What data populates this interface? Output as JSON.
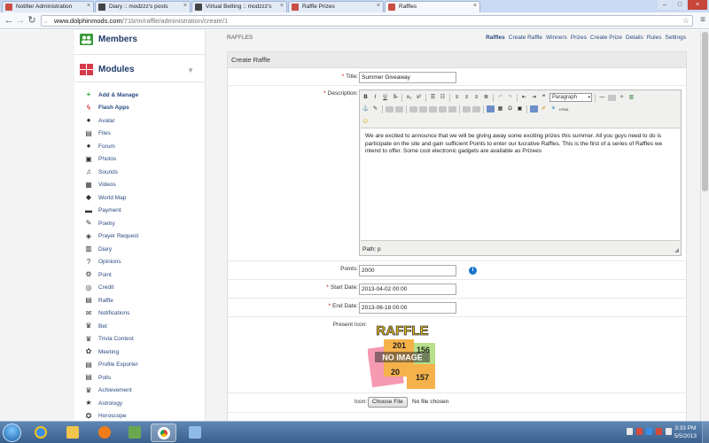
{
  "browser": {
    "tabs": [
      {
        "label": "Notifier Administration",
        "favicon_color": "#c94e44",
        "active": false
      },
      {
        "label": "Diary :: modzzz's posts",
        "favicon_color": "#444444",
        "active": false
      },
      {
        "label": "Virtual Betting :: modzzz's",
        "favicon_color": "#444444",
        "active": false
      },
      {
        "label": "Raffle Prizes",
        "favicon_color": "#c94e44",
        "active": false
      },
      {
        "label": "Raffles",
        "favicon_color": "#c94e44",
        "active": true
      }
    ],
    "url_host": "www.dolphinmods.com",
    "url_path": "/71b/m/raffle/administration/create/1"
  },
  "sidebar": {
    "members_label": "Members",
    "modules_label": "Modules",
    "items": [
      {
        "label": "Add & Manage",
        "icon": "plus-icon",
        "glyph": "+",
        "color": "#2e9e2e",
        "bold": true
      },
      {
        "label": "Flash Apps",
        "icon": "flash-icon",
        "glyph": "ϟ",
        "color": "#d42e2e",
        "bold": true
      },
      {
        "label": "Avatar",
        "icon": "avatar-icon",
        "glyph": "●",
        "color": "#333",
        "bold": false
      },
      {
        "label": "Files",
        "icon": "files-icon",
        "glyph": "▤",
        "color": "#333",
        "bold": false
      },
      {
        "label": "Forum",
        "icon": "forum-icon",
        "glyph": "●",
        "color": "#333",
        "bold": false
      },
      {
        "label": "Photos",
        "icon": "photos-icon",
        "glyph": "▣",
        "color": "#333",
        "bold": false
      },
      {
        "label": "Sounds",
        "icon": "sounds-icon",
        "glyph": "♫",
        "color": "#333",
        "bold": false
      },
      {
        "label": "Videos",
        "icon": "videos-icon",
        "glyph": "▦",
        "color": "#333",
        "bold": false
      },
      {
        "label": "World Map",
        "icon": "map-pin-icon",
        "glyph": "◆",
        "color": "#333",
        "bold": false
      },
      {
        "label": "Payment",
        "icon": "payment-icon",
        "glyph": "▬",
        "color": "#333",
        "bold": false
      },
      {
        "label": "Poetry",
        "icon": "pencil-icon",
        "glyph": "✎",
        "color": "#333",
        "bold": false
      },
      {
        "label": "Prayer Request",
        "icon": "tag-icon",
        "glyph": "◈",
        "color": "#333",
        "bold": false
      },
      {
        "label": "Diary",
        "icon": "diary-icon",
        "glyph": "▥",
        "color": "#333",
        "bold": false
      },
      {
        "label": "Opinions",
        "icon": "question-icon",
        "glyph": "?",
        "color": "#333",
        "bold": false
      },
      {
        "label": "Point",
        "icon": "point-icon",
        "glyph": "⚙",
        "color": "#333",
        "bold": false
      },
      {
        "label": "Credit",
        "icon": "credit-icon",
        "glyph": "◎",
        "color": "#333",
        "bold": false
      },
      {
        "label": "Raffle",
        "icon": "raffle-icon",
        "glyph": "▤",
        "color": "#333",
        "bold": false
      },
      {
        "label": "Notifications",
        "icon": "mail-icon",
        "glyph": "✉",
        "color": "#333",
        "bold": false
      },
      {
        "label": "Bet",
        "icon": "trophy-icon",
        "glyph": "♛",
        "color": "#333",
        "bold": false
      },
      {
        "label": "Trivia Contest",
        "icon": "trophy-icon",
        "glyph": "♛",
        "color": "#333",
        "bold": false
      },
      {
        "label": "Meeting",
        "icon": "meeting-icon",
        "glyph": "✿",
        "color": "#333",
        "bold": false
      },
      {
        "label": "Profile Exporter",
        "icon": "exporter-icon",
        "glyph": "▤",
        "color": "#333",
        "bold": false
      },
      {
        "label": "Polls",
        "icon": "polls-icon",
        "glyph": "▤",
        "color": "#333",
        "bold": false
      },
      {
        "label": "Achievement",
        "icon": "trophy-icon",
        "glyph": "♛",
        "color": "#333",
        "bold": false
      },
      {
        "label": "Astrology",
        "icon": "star-icon",
        "glyph": "★",
        "color": "#333",
        "bold": false
      },
      {
        "label": "Horoscope",
        "icon": "horoscope-icon",
        "glyph": "✪",
        "color": "#333",
        "bold": false
      }
    ]
  },
  "main": {
    "breadcrumb": "RAFFLES",
    "topnav": [
      "Raffles",
      "Create Raffle",
      "Winners",
      "Prizes",
      "Create Prize",
      "Details",
      "Rules",
      "Settings"
    ],
    "box_title": "Create Raffle",
    "form": {
      "title_label": "Title:",
      "title_value": "Summer Giveaway",
      "description_label": "Description:",
      "description_text": "We are excited to announce that we will be giving away some exciting prizes this summer. All you guys need to do is participate on the site and gain sufficient Points to enter our lucrative Raffles. This is the first of a series of Raffles we intend to offer. Some cool electronic gadgets are available as Prizees",
      "format_select": "Paragraph",
      "editor_path": "Path: p",
      "points_label": "Points:",
      "points_value": "2000",
      "start_label": "Start Date:",
      "start_value": "2013-04-02 00:00",
      "end_label": "End Date:",
      "end_value": "2013-06-18 00:00",
      "present_icon_label": "Present Icon:",
      "raffle_logo_text": "RAFFLE",
      "no_image_text": "NO IMAGE",
      "ticket_numbers": [
        "201",
        "156",
        "20",
        "157"
      ],
      "icon_label": "Icon:",
      "choose_file_label": "Choose File",
      "no_file_text": "No file chosen"
    }
  },
  "taskbar": {
    "time": "3:33 PM",
    "date": "5/5/2013"
  }
}
